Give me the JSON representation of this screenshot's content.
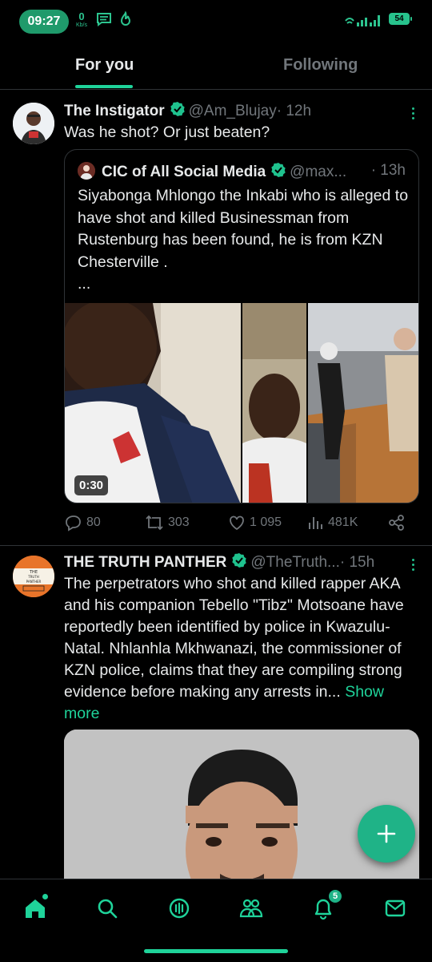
{
  "status_bar": {
    "time": "09:27",
    "net_speed_value": "0",
    "net_speed_unit": "Kb/s",
    "battery": "54"
  },
  "tabs": [
    {
      "label": "For you",
      "active": true
    },
    {
      "label": "Following",
      "active": false
    }
  ],
  "posts": [
    {
      "display_name": "The Instigator",
      "handle": "@Am_Blujay",
      "time": "· 12h",
      "text": "Was he shot? Or just beaten?",
      "quote": {
        "display_name": "CIC of All Social Media",
        "handle": "@max...",
        "time": "· 13h",
        "text": "Siyabonga Mhlongo the Inkabi who  is alleged to have shot and killed Businessman from Rustenburg has been found, he is from KZN Chesterville .",
        "ellipsis": "...",
        "video_duration": "0:30"
      },
      "actions": {
        "replies": "80",
        "reposts": "303",
        "likes": "1 095",
        "views": "481K"
      }
    },
    {
      "display_name": "THE TRUTH PANTHER",
      "handle": "@TheTruth...",
      "time": "· 15h",
      "text": "The perpetrators who shot and killed rapper AKA and his companion Tebello \"Tibz\" Motsoane have reportedly been identified by police in Kwazulu-Natal. Nhlanhla Mkhwanazi, the commissioner of KZN police, claims that they are compiling strong evidence before making any arrests in...",
      "show_more": "Show more",
      "avatar_text": [
        "THE",
        "TRUTH",
        "PANTHER"
      ]
    }
  ],
  "bottom_nav": {
    "notifications_badge": "5"
  },
  "colors": {
    "accent": "#1fd39a",
    "background": "#000000",
    "verified": "#1fc28e"
  }
}
